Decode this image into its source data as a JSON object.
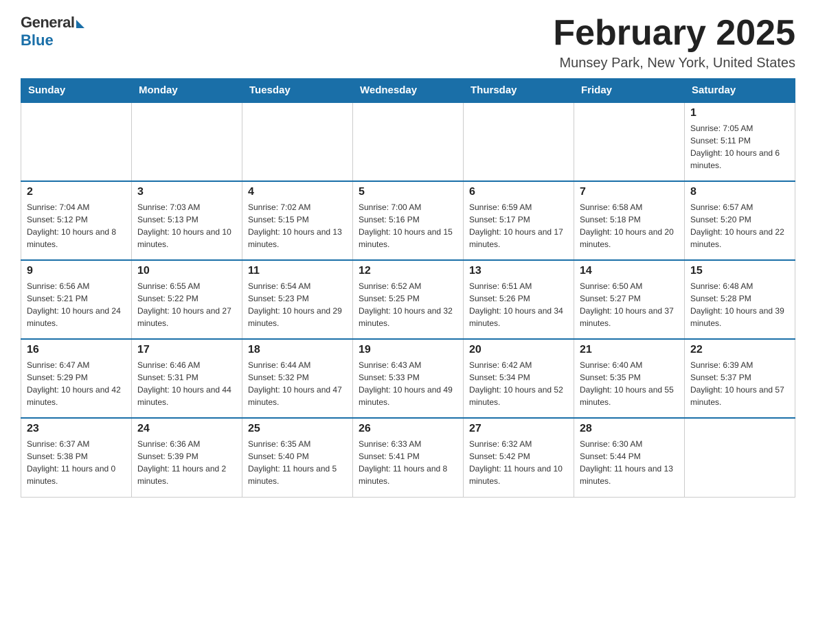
{
  "logo": {
    "general": "General",
    "blue": "Blue"
  },
  "header": {
    "title": "February 2025",
    "location": "Munsey Park, New York, United States"
  },
  "weekdays": [
    "Sunday",
    "Monday",
    "Tuesday",
    "Wednesday",
    "Thursday",
    "Friday",
    "Saturday"
  ],
  "weeks": [
    [
      {
        "day": "",
        "info": ""
      },
      {
        "day": "",
        "info": ""
      },
      {
        "day": "",
        "info": ""
      },
      {
        "day": "",
        "info": ""
      },
      {
        "day": "",
        "info": ""
      },
      {
        "day": "",
        "info": ""
      },
      {
        "day": "1",
        "info": "Sunrise: 7:05 AM\nSunset: 5:11 PM\nDaylight: 10 hours and 6 minutes."
      }
    ],
    [
      {
        "day": "2",
        "info": "Sunrise: 7:04 AM\nSunset: 5:12 PM\nDaylight: 10 hours and 8 minutes."
      },
      {
        "day": "3",
        "info": "Sunrise: 7:03 AM\nSunset: 5:13 PM\nDaylight: 10 hours and 10 minutes."
      },
      {
        "day": "4",
        "info": "Sunrise: 7:02 AM\nSunset: 5:15 PM\nDaylight: 10 hours and 13 minutes."
      },
      {
        "day": "5",
        "info": "Sunrise: 7:00 AM\nSunset: 5:16 PM\nDaylight: 10 hours and 15 minutes."
      },
      {
        "day": "6",
        "info": "Sunrise: 6:59 AM\nSunset: 5:17 PM\nDaylight: 10 hours and 17 minutes."
      },
      {
        "day": "7",
        "info": "Sunrise: 6:58 AM\nSunset: 5:18 PM\nDaylight: 10 hours and 20 minutes."
      },
      {
        "day": "8",
        "info": "Sunrise: 6:57 AM\nSunset: 5:20 PM\nDaylight: 10 hours and 22 minutes."
      }
    ],
    [
      {
        "day": "9",
        "info": "Sunrise: 6:56 AM\nSunset: 5:21 PM\nDaylight: 10 hours and 24 minutes."
      },
      {
        "day": "10",
        "info": "Sunrise: 6:55 AM\nSunset: 5:22 PM\nDaylight: 10 hours and 27 minutes."
      },
      {
        "day": "11",
        "info": "Sunrise: 6:54 AM\nSunset: 5:23 PM\nDaylight: 10 hours and 29 minutes."
      },
      {
        "day": "12",
        "info": "Sunrise: 6:52 AM\nSunset: 5:25 PM\nDaylight: 10 hours and 32 minutes."
      },
      {
        "day": "13",
        "info": "Sunrise: 6:51 AM\nSunset: 5:26 PM\nDaylight: 10 hours and 34 minutes."
      },
      {
        "day": "14",
        "info": "Sunrise: 6:50 AM\nSunset: 5:27 PM\nDaylight: 10 hours and 37 minutes."
      },
      {
        "day": "15",
        "info": "Sunrise: 6:48 AM\nSunset: 5:28 PM\nDaylight: 10 hours and 39 minutes."
      }
    ],
    [
      {
        "day": "16",
        "info": "Sunrise: 6:47 AM\nSunset: 5:29 PM\nDaylight: 10 hours and 42 minutes."
      },
      {
        "day": "17",
        "info": "Sunrise: 6:46 AM\nSunset: 5:31 PM\nDaylight: 10 hours and 44 minutes."
      },
      {
        "day": "18",
        "info": "Sunrise: 6:44 AM\nSunset: 5:32 PM\nDaylight: 10 hours and 47 minutes."
      },
      {
        "day": "19",
        "info": "Sunrise: 6:43 AM\nSunset: 5:33 PM\nDaylight: 10 hours and 49 minutes."
      },
      {
        "day": "20",
        "info": "Sunrise: 6:42 AM\nSunset: 5:34 PM\nDaylight: 10 hours and 52 minutes."
      },
      {
        "day": "21",
        "info": "Sunrise: 6:40 AM\nSunset: 5:35 PM\nDaylight: 10 hours and 55 minutes."
      },
      {
        "day": "22",
        "info": "Sunrise: 6:39 AM\nSunset: 5:37 PM\nDaylight: 10 hours and 57 minutes."
      }
    ],
    [
      {
        "day": "23",
        "info": "Sunrise: 6:37 AM\nSunset: 5:38 PM\nDaylight: 11 hours and 0 minutes."
      },
      {
        "day": "24",
        "info": "Sunrise: 6:36 AM\nSunset: 5:39 PM\nDaylight: 11 hours and 2 minutes."
      },
      {
        "day": "25",
        "info": "Sunrise: 6:35 AM\nSunset: 5:40 PM\nDaylight: 11 hours and 5 minutes."
      },
      {
        "day": "26",
        "info": "Sunrise: 6:33 AM\nSunset: 5:41 PM\nDaylight: 11 hours and 8 minutes."
      },
      {
        "day": "27",
        "info": "Sunrise: 6:32 AM\nSunset: 5:42 PM\nDaylight: 11 hours and 10 minutes."
      },
      {
        "day": "28",
        "info": "Sunrise: 6:30 AM\nSunset: 5:44 PM\nDaylight: 11 hours and 13 minutes."
      },
      {
        "day": "",
        "info": ""
      }
    ]
  ]
}
